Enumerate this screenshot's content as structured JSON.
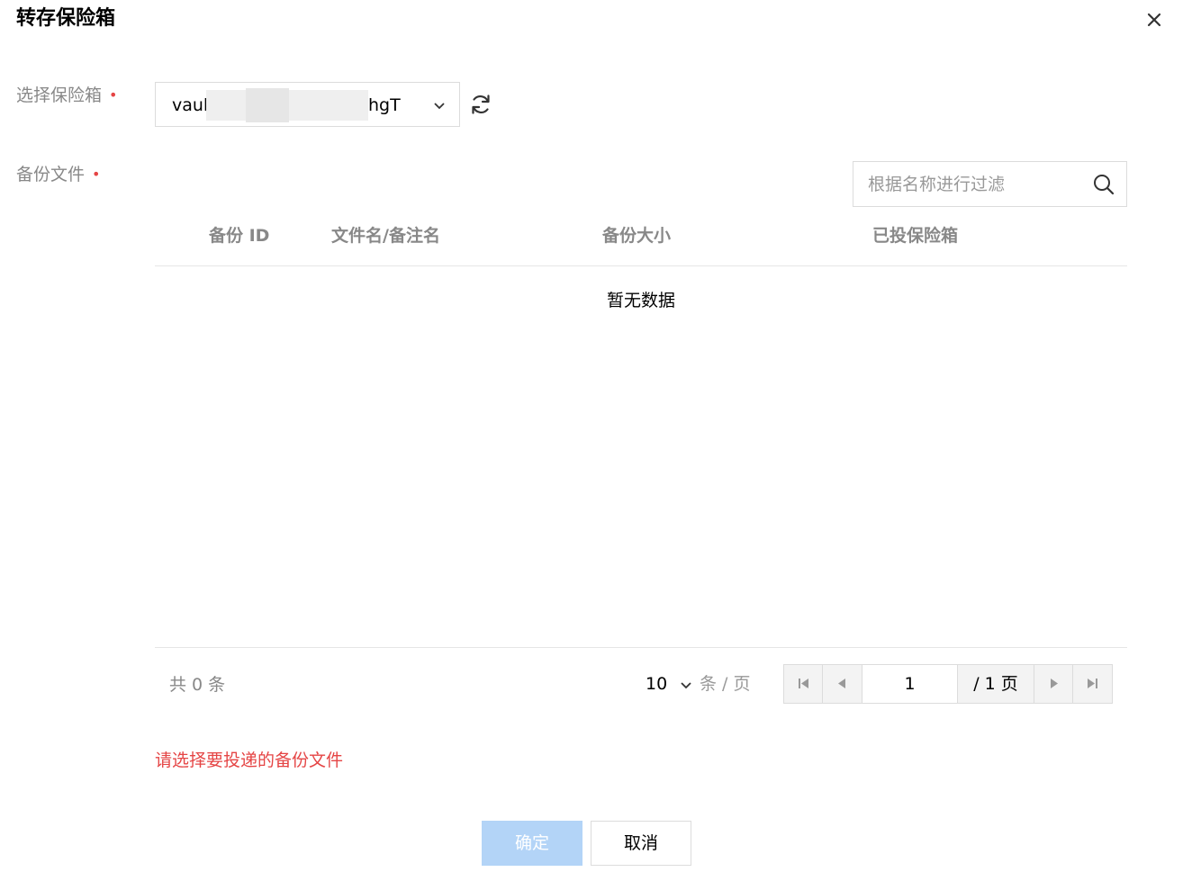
{
  "dialog": {
    "title": "转存保险箱"
  },
  "form": {
    "vault_label": "选择保险箱",
    "backup_label": "备份文件",
    "vault_select": {
      "value_prefix": "vaul",
      "value_suffix": "hgT"
    }
  },
  "search": {
    "placeholder": "根据名称进行过滤"
  },
  "table": {
    "columns": [
      "备份 ID",
      "文件名/备注名",
      "备份大小",
      "已投保险箱"
    ],
    "empty_text": "暂无数据"
  },
  "footer": {
    "total_text": "共 0 条",
    "page_size": "10",
    "per_page_text": "条 / 页",
    "current_page": "1",
    "total_pages_text": "/ 1 页"
  },
  "error_text": "请选择要投递的备份文件",
  "buttons": {
    "ok_label": "确定",
    "cancel_label": "取消"
  },
  "colors": {
    "required": "#e54545",
    "primary_disabled": "#b3d4f7",
    "error": "#e54545"
  },
  "icons": [
    "close-icon",
    "chevron-down-icon",
    "refresh-icon",
    "search-icon",
    "first-page-icon",
    "prev-page-icon",
    "next-page-icon",
    "last-page-icon"
  ]
}
